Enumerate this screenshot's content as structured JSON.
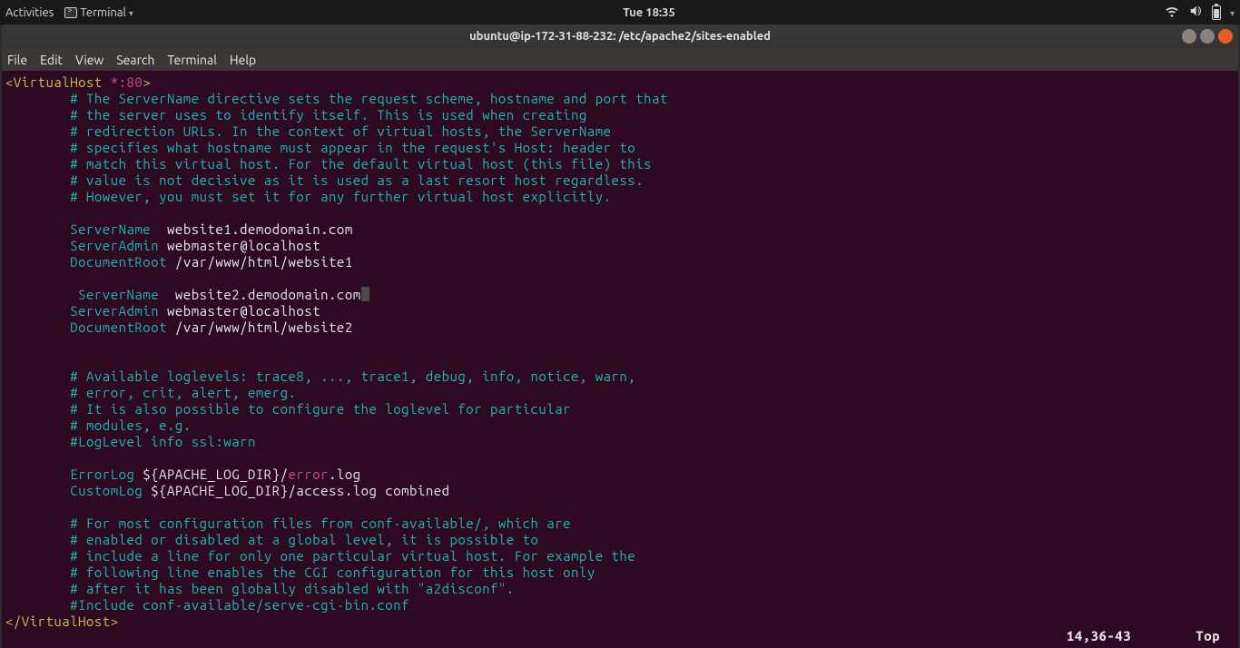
{
  "topbar": {
    "activities": "Activities",
    "terminal": "Terminal",
    "clock": "Tue 18:35"
  },
  "window": {
    "title": "ubuntu@ip-172-31-88-232: /etc/apache2/sites-enabled"
  },
  "menubar": {
    "file": "File",
    "edit": "Edit",
    "view": "View",
    "search": "Search",
    "terminal": "Terminal",
    "help": "Help"
  },
  "content": {
    "open_tag_l": "<VirtualHost",
    "open_tag_port": " *:80",
    "gt": ">",
    "c1": "# The ServerName directive sets the request scheme, hostname and port that",
    "c2": "# the server uses to identify itself. This is used when creating",
    "c3": "# redirection URLs. In the context of virtual hosts, the ServerName",
    "c4": "# specifies what hostname must appear in the request's Host: header to",
    "c5": "# match this virtual host. For the default virtual host (this file) this",
    "c6": "# value is not decisive as it is used as a last resort host regardless.",
    "c7": "# However, you must set it for any further virtual host explicitly.",
    "sn1_k": "ServerName",
    "sn1_v": "  website1.demodomain.com",
    "sa1_k": "ServerAdmin",
    "sa1_v": " webmaster@localhost",
    "dr1_k": "DocumentRoot",
    "dr1_v": " /var/www/html/website1",
    "sn2_k": "ServerName",
    "sn2_v": "  website2.demodomain.com",
    "sa2_k": "ServerAdmin",
    "sa2_v": " webmaster@localhost",
    "dr2_k": "DocumentRoot",
    "dr2_v": " /var/www/html/website2",
    "cA": "# Available loglevels: trace8, ..., trace1, debug, info, notice, warn,",
    "cB": "# error, crit, alert, emerg.",
    "cC": "# It is also possible to configure the loglevel for particular",
    "cD": "# modules, e.g.",
    "cE": "#LogLevel info ssl:warn",
    "el_k": "ErrorLog",
    "el_v1": " ${APACHE_LOG_DIR}/",
    "el_err": "error",
    "el_v2": ".log",
    "cl_k": "CustomLog",
    "cl_v": " ${APACHE_LOG_DIR}/access.log combined",
    "cF": "# For most configuration files from conf-available/, which are",
    "cG": "# enabled or disabled at a global level, it is possible to",
    "cH": "# include a line for only one particular virtual host. For example the",
    "cI": "# following line enables the CGI configuration for this host only",
    "cJ": "# after it has been globally disabled with \"a2disconf\".",
    "cK": "#Include conf-available/serve-cgi-bin.conf",
    "close_tag": "</VirtualHost>"
  },
  "status": {
    "pos": "14,36-43",
    "loc": "Top"
  }
}
